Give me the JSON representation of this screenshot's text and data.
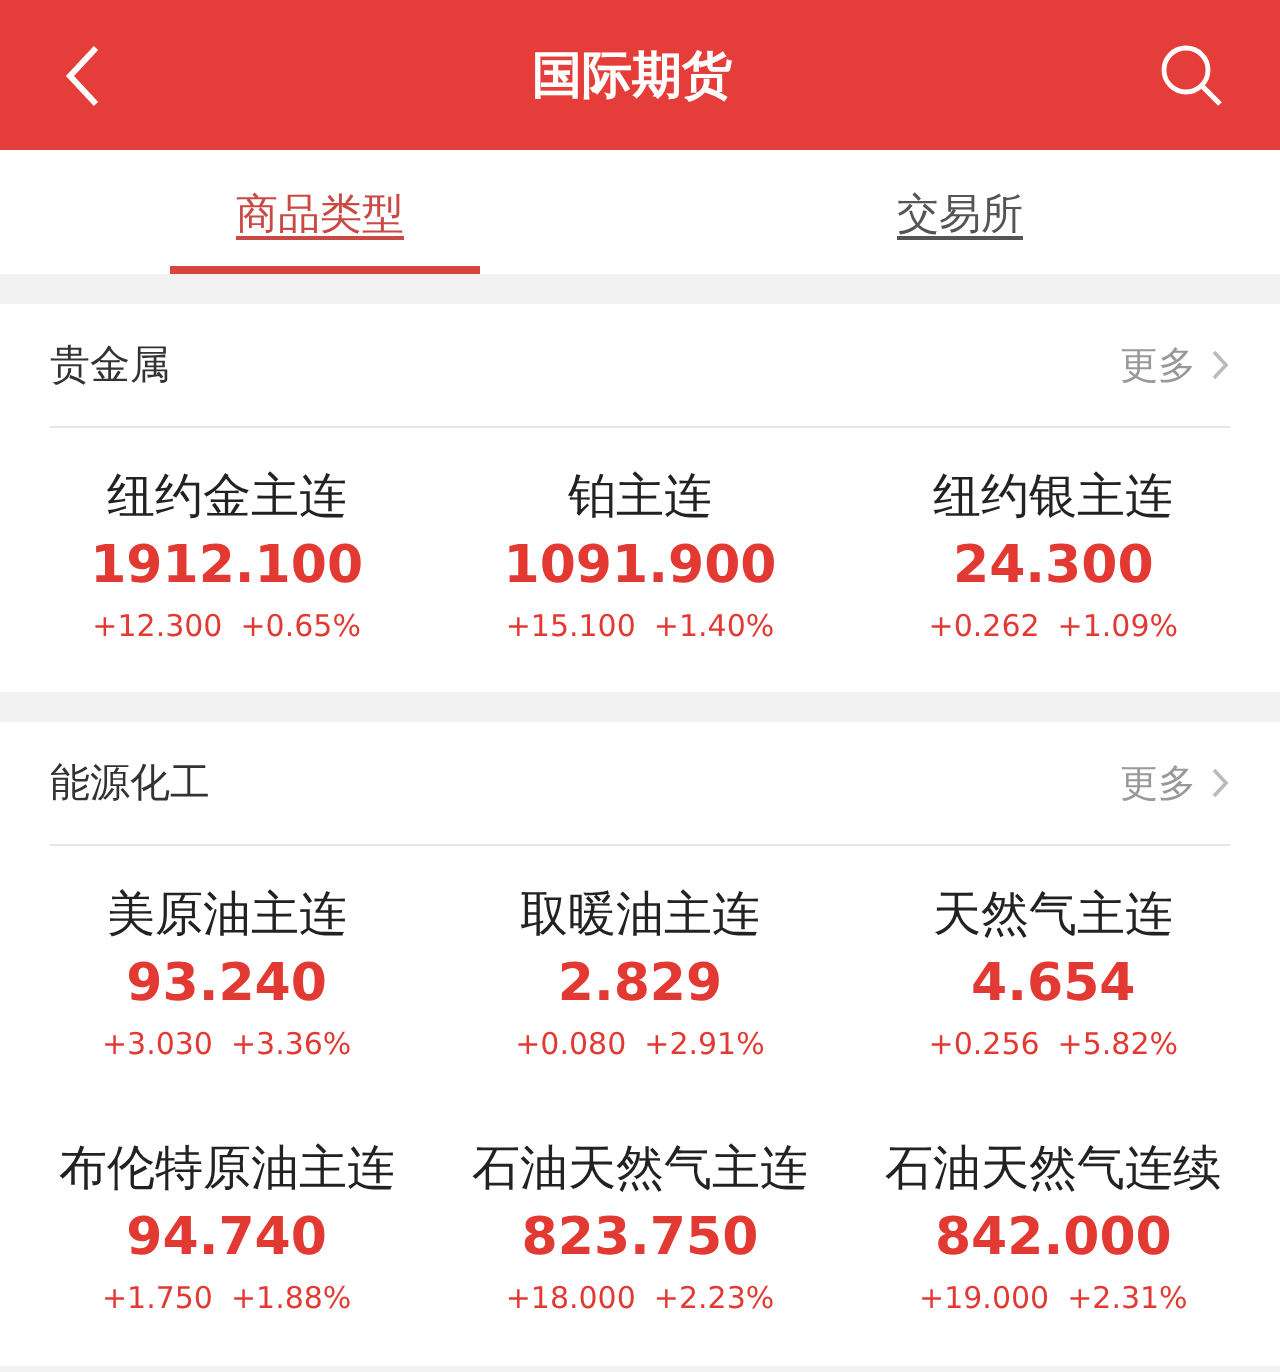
{
  "header": {
    "title": "国际期货"
  },
  "tabs": [
    {
      "label": "商品类型",
      "selected": true
    },
    {
      "label": "交易所",
      "selected": false
    }
  ],
  "sections": [
    {
      "title": "贵金属",
      "more": "更多",
      "quotes": [
        {
          "name": "纽约金主连",
          "price": "1912.100",
          "change": "+12.300",
          "percent": "+0.65%",
          "kind": "up"
        },
        {
          "name": "铂主连",
          "price": "1091.900",
          "change": "+15.100",
          "percent": "+1.40%",
          "kind": "up"
        },
        {
          "name": "纽约银主连",
          "price": "24.300",
          "change": "+0.262",
          "percent": "+1.09%",
          "kind": "up"
        }
      ]
    },
    {
      "title": "能源化工",
      "more": "更多",
      "quotes": [
        {
          "name": "美原油主连",
          "price": "93.240",
          "change": "+3.030",
          "percent": "+3.36%",
          "kind": "up"
        },
        {
          "name": "取暖油主连",
          "price": "2.829",
          "change": "+0.080",
          "percent": "+2.91%",
          "kind": "up"
        },
        {
          "name": "天然气主连",
          "price": "4.654",
          "change": "+0.256",
          "percent": "+5.82%",
          "kind": "up"
        },
        {
          "name": "布伦特原油主连",
          "price": "94.740",
          "change": "+1.750",
          "percent": "+1.88%",
          "kind": "up"
        },
        {
          "name": "石油天然气主连",
          "price": "823.750",
          "change": "+18.000",
          "percent": "+2.23%",
          "kind": "up"
        },
        {
          "name": "石油天然气连续",
          "price": "842.000",
          "change": "+19.000",
          "percent": "+2.31%",
          "kind": "up"
        }
      ]
    }
  ]
}
